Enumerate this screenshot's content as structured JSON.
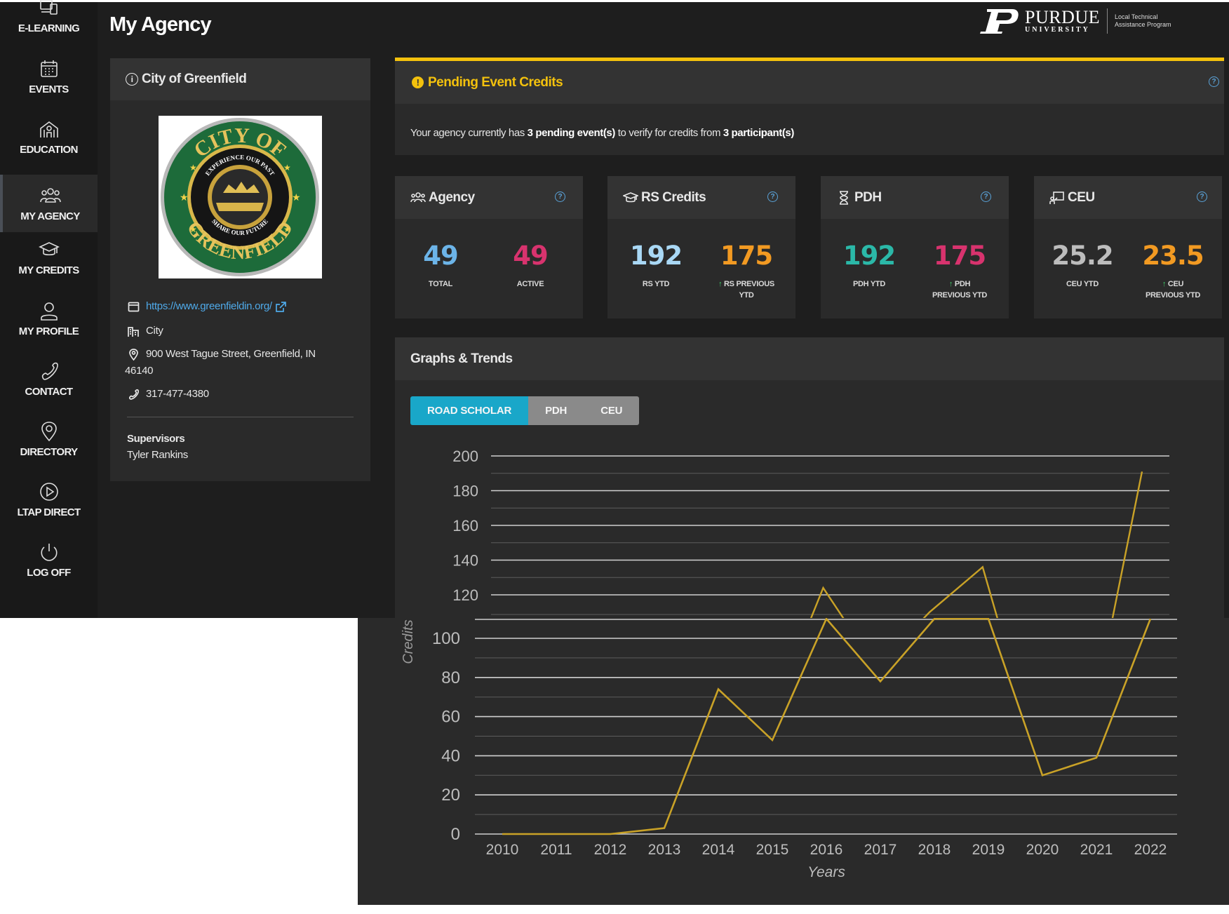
{
  "page": {
    "title": "My Agency"
  },
  "brand": {
    "university": "PURDUE",
    "subline": "UNIVERSITY",
    "program_line1": "Local Technical",
    "program_line2": "Assistance Program"
  },
  "sidebar": {
    "items": [
      {
        "label": "E-LEARNING",
        "icon": "devices-icon"
      },
      {
        "label": "EVENTS",
        "icon": "calendar-icon"
      },
      {
        "label": "EDUCATION",
        "icon": "school-icon"
      },
      {
        "label": "MY AGENCY",
        "icon": "people-icon",
        "active": true
      },
      {
        "label": "MY CREDITS",
        "icon": "graduation-cap-icon"
      },
      {
        "label": "MY PROFILE",
        "icon": "user-icon"
      },
      {
        "label": "CONTACT",
        "icon": "phone-icon"
      },
      {
        "label": "DIRECTORY",
        "icon": "map-pin-icon"
      },
      {
        "label": "LTAP DIRECT",
        "icon": "play-icon"
      },
      {
        "label": "LOG OFF",
        "icon": "power-icon"
      }
    ]
  },
  "agency": {
    "name": "City of Greenfield",
    "website": "https://www.greenfieldin.org/",
    "type": "City",
    "address": "900 West Tague Street, Greenfield, IN",
    "address_line2": "46140",
    "phone": "317-477-4380",
    "supervisors_label": "Supervisors",
    "supervisor": "Tyler Rankins",
    "seal_text_top": "CITY OF",
    "seal_text_bottom": "GREENFIELD",
    "seal_motto_top": "EXPERIENCE OUR PAST",
    "seal_motto_bottom": "SHARE OUR FUTURE"
  },
  "pending": {
    "title": "Pending Event Credits",
    "msg_pre": "Your agency currently has ",
    "msg_events": "3 pending event(s)",
    "msg_mid": " to verify for credits from ",
    "msg_participants": "3 participant(s)"
  },
  "stats": [
    {
      "title": "Agency",
      "icon": "people-icon",
      "v1": "49",
      "c1": "TOTAL",
      "v2": "49",
      "c2": "ACTIVE",
      "c2b": "",
      "up": false,
      "col1": "#6cb4e8",
      "col2": "#d8336e"
    },
    {
      "title": "RS Credits",
      "icon": "graduation-cap-icon",
      "v1": "192",
      "c1": "RS YTD",
      "v2": "175",
      "c2": "RS PREVIOUS",
      "c2b": "YTD",
      "up": true,
      "col1": "#a9d8f5",
      "col2": "#f29a22"
    },
    {
      "title": "PDH",
      "icon": "hourglass-icon",
      "v1": "192",
      "c1": "PDH YTD",
      "v2": "175",
      "c2": "PDH",
      "c2b": "PREVIOUS YTD",
      "up": true,
      "col1": "#2bb8a8",
      "col2": "#d8336e"
    },
    {
      "title": "CEU",
      "icon": "presentation-icon",
      "v1": "25.2",
      "c1": "CEU YTD",
      "v2": "23.5",
      "c2": "CEU",
      "c2b": "PREVIOUS YTD",
      "up": true,
      "col1": "#bdbdbd",
      "col2": "#f29a22"
    }
  ],
  "graphs": {
    "title": "Graphs & Trends",
    "tabs": [
      "ROAD SCHOLAR",
      "PDH",
      "CEU"
    ],
    "active_tab": 0
  },
  "chart_data": {
    "type": "line",
    "xlabel": "Years",
    "ylabel": "Credits",
    "x": [
      "2010",
      "2011",
      "2012",
      "2013",
      "2014",
      "2015",
      "2016",
      "2017",
      "2018",
      "2019",
      "2020",
      "2021",
      "2022"
    ],
    "series": [
      {
        "values": [
          0,
          0,
          0,
          3,
          74,
          48,
          124,
          78,
          110,
          136,
          30,
          39,
          191
        ]
      }
    ],
    "ylim": [
      0,
      200
    ],
    "yticks": [
      0,
      20,
      40,
      60,
      80,
      100,
      120,
      140,
      160,
      180,
      200
    ],
    "line_color": "#c9a227",
    "grid": true
  }
}
